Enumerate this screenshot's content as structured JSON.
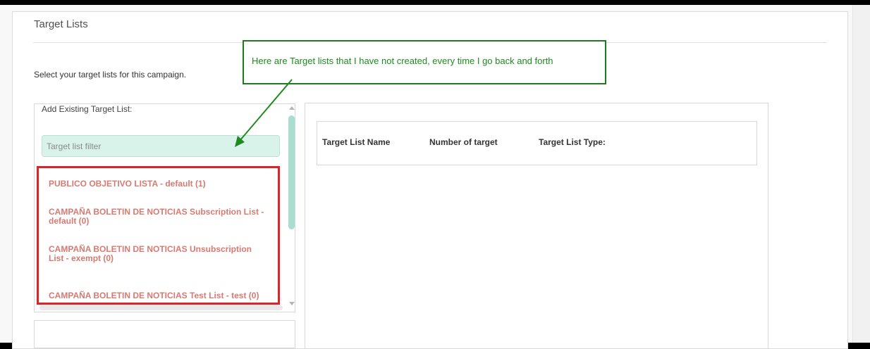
{
  "section": {
    "title": "Target Lists",
    "instruction": "Select your target lists for this campaign."
  },
  "left_panel": {
    "label": "Add Existing Target List:",
    "filter_placeholder": "Target list filter",
    "items": [
      "PUBLICO OBJETIVO LISTA - default (1)",
      "CAMPAÑA BOLETIN DE NOTICIAS Subscription List - default (0)",
      "CAMPAÑA BOLETIN DE NOTICIAS Unsubscription List - exempt (0)",
      "CAMPAÑA BOLETIN DE NOTICIAS Test List - test (0)"
    ]
  },
  "right_panel": {
    "headers": [
      "Target List Name",
      "Number of target",
      "Target List Type:"
    ]
  },
  "annotation": {
    "text": "Here are Target lists that I have not created, every time I go back and forth",
    "color": "#1f8a1f",
    "highlight_color": "#d6262b"
  },
  "colors": {
    "filter_bg": "#d9f3ea",
    "list_item_text": "#d77a72"
  }
}
